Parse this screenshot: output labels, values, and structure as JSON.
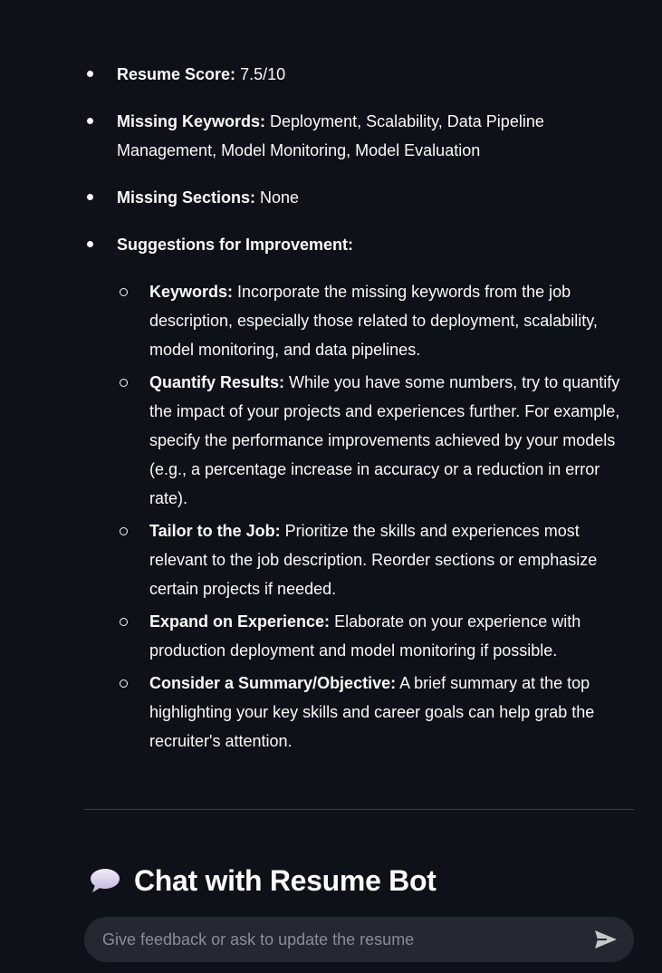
{
  "evaluation": {
    "items": [
      {
        "label": "Resume Score:",
        "text": " 7.5/10"
      },
      {
        "label": "Missing Keywords:",
        "text": " Deployment, Scalability, Data Pipeline Management, Model Monitoring, Model Evaluation"
      },
      {
        "label": "Missing Sections:",
        "text": " None"
      },
      {
        "label": "Suggestions for Improvement:",
        "text": ""
      }
    ],
    "suggestions": [
      {
        "label": "Keywords:",
        "text": " Incorporate the missing keywords from the job description, especially those related to deployment, scalability, model monitoring, and data pipelines."
      },
      {
        "label": "Quantify Results:",
        "text": " While you have some numbers, try to quantify the impact of your projects and experiences further. For example, specify the performance improvements achieved by your models (e.g., a percentage increase in accuracy or a reduction in error rate)."
      },
      {
        "label": "Tailor to the Job:",
        "text": " Prioritize the skills and experiences most relevant to the job description. Reorder sections or emphasize certain projects if needed."
      },
      {
        "label": "Expand on Experience:",
        "text": " Elaborate on your experience with production deployment and model monitoring if possible."
      },
      {
        "label": "Consider a Summary/Objective:",
        "text": " A brief summary at the top highlighting your key skills and career goals can help grab the recruiter's attention."
      }
    ]
  },
  "chat": {
    "heading": "Chat with Resume Bot",
    "heading_icon": "speech-bubble-icon",
    "input_placeholder": "Give feedback or ask to update the resume",
    "input_value": "",
    "send_icon": "send-icon"
  },
  "colors": {
    "background": "#0e1117",
    "text": "#fafafa",
    "input_background": "#262730",
    "placeholder": "#8b8d95",
    "divider": "#3a3d44"
  }
}
